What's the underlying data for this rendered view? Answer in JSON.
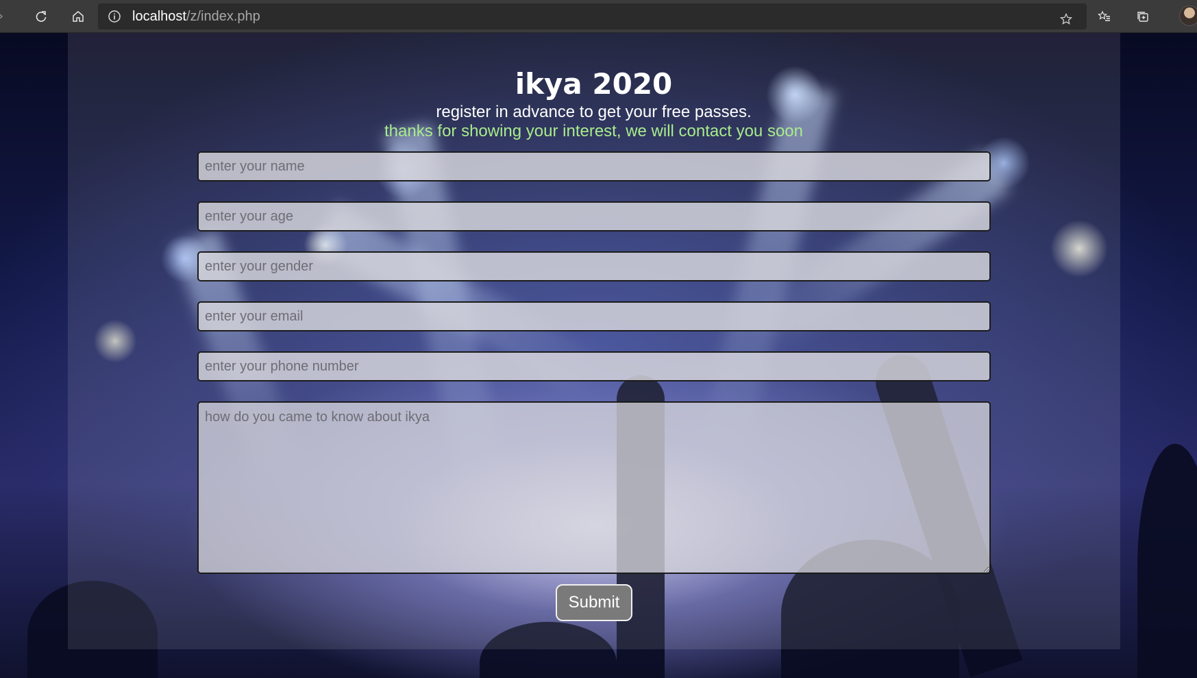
{
  "browser": {
    "url_host": "localhost",
    "url_path": "/z/index.php"
  },
  "page": {
    "title": "ikya 2020",
    "subtitle": "register in advance to get your free passes.",
    "success_message": "thanks for showing your interest, we will contact you soon"
  },
  "form": {
    "name_placeholder": "enter your name",
    "age_placeholder": "enter your age",
    "gender_placeholder": "enter your gender",
    "email_placeholder": "enter your email",
    "phone_placeholder": "enter your phone number",
    "message_placeholder": "how do you came to know about ikya",
    "submit_label": "Submit"
  },
  "colors": {
    "success_text": "#a8ec8c",
    "chrome_bg": "#3b3b3b",
    "submit_bg": "#7a7a7a"
  },
  "icons": [
    "forward-icon",
    "reload-icon",
    "home-icon",
    "info-icon",
    "star-icon",
    "favorites-icon",
    "collections-icon",
    "profile-avatar"
  ]
}
